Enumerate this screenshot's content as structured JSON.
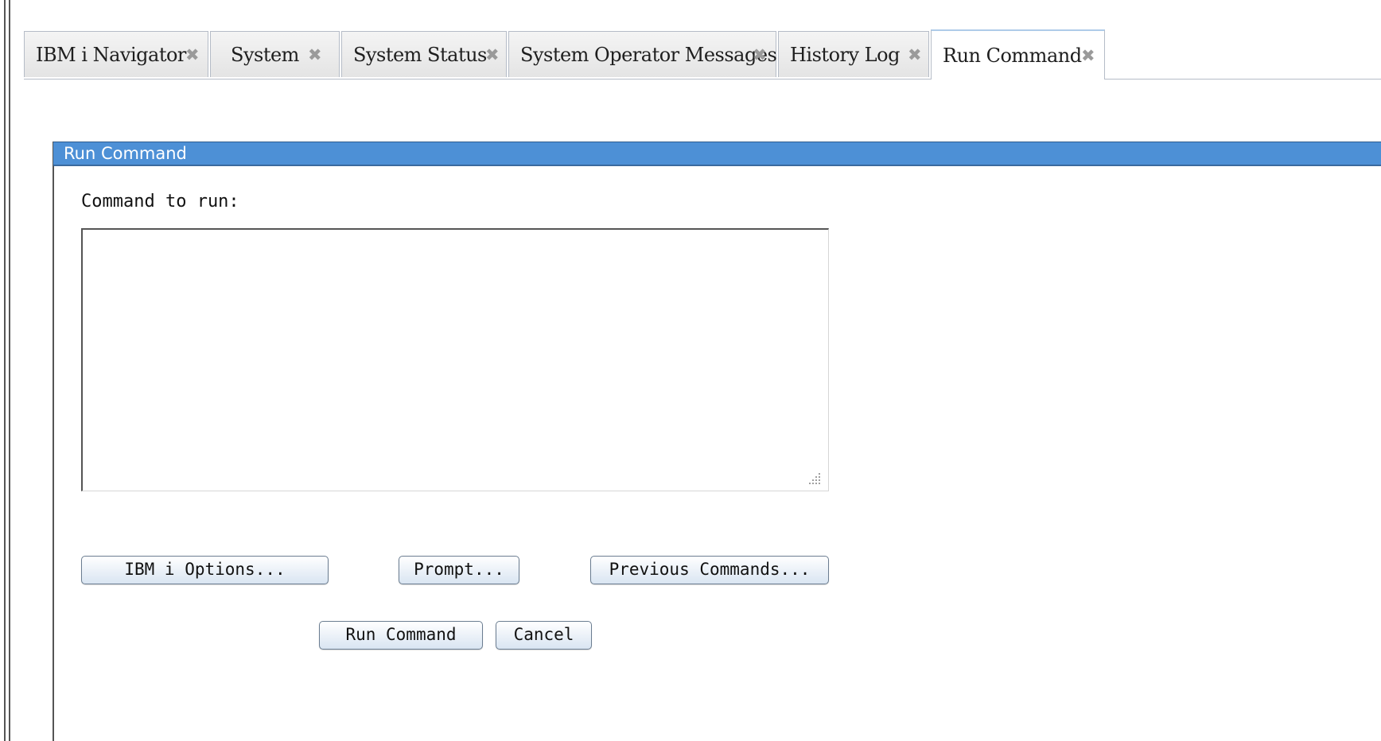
{
  "tabs": [
    {
      "label": "IBM i Navigator",
      "active": false
    },
    {
      "label": "System",
      "active": false
    },
    {
      "label": "System Status",
      "active": false
    },
    {
      "label": "System Operator Messages",
      "active": false
    },
    {
      "label": "History Log",
      "active": false
    },
    {
      "label": "Run Command",
      "active": true
    }
  ],
  "tab_close_glyph": "✖",
  "panel": {
    "title": "Run Command",
    "command_label": "Command to run:",
    "command_value": ""
  },
  "buttons": {
    "ibmi_options": "IBM i Options...",
    "prompt": "Prompt...",
    "previous_commands": "Previous Commands...",
    "run_command": "Run Command",
    "cancel": "Cancel"
  },
  "icons": {
    "tab_close": "close-icon",
    "textarea_resize": "resize-grip-icon"
  },
  "colors": {
    "panel_header": "#4d90d6",
    "panel_title_text": "#ffffff",
    "active_tab_accent": "#aecbe9"
  }
}
